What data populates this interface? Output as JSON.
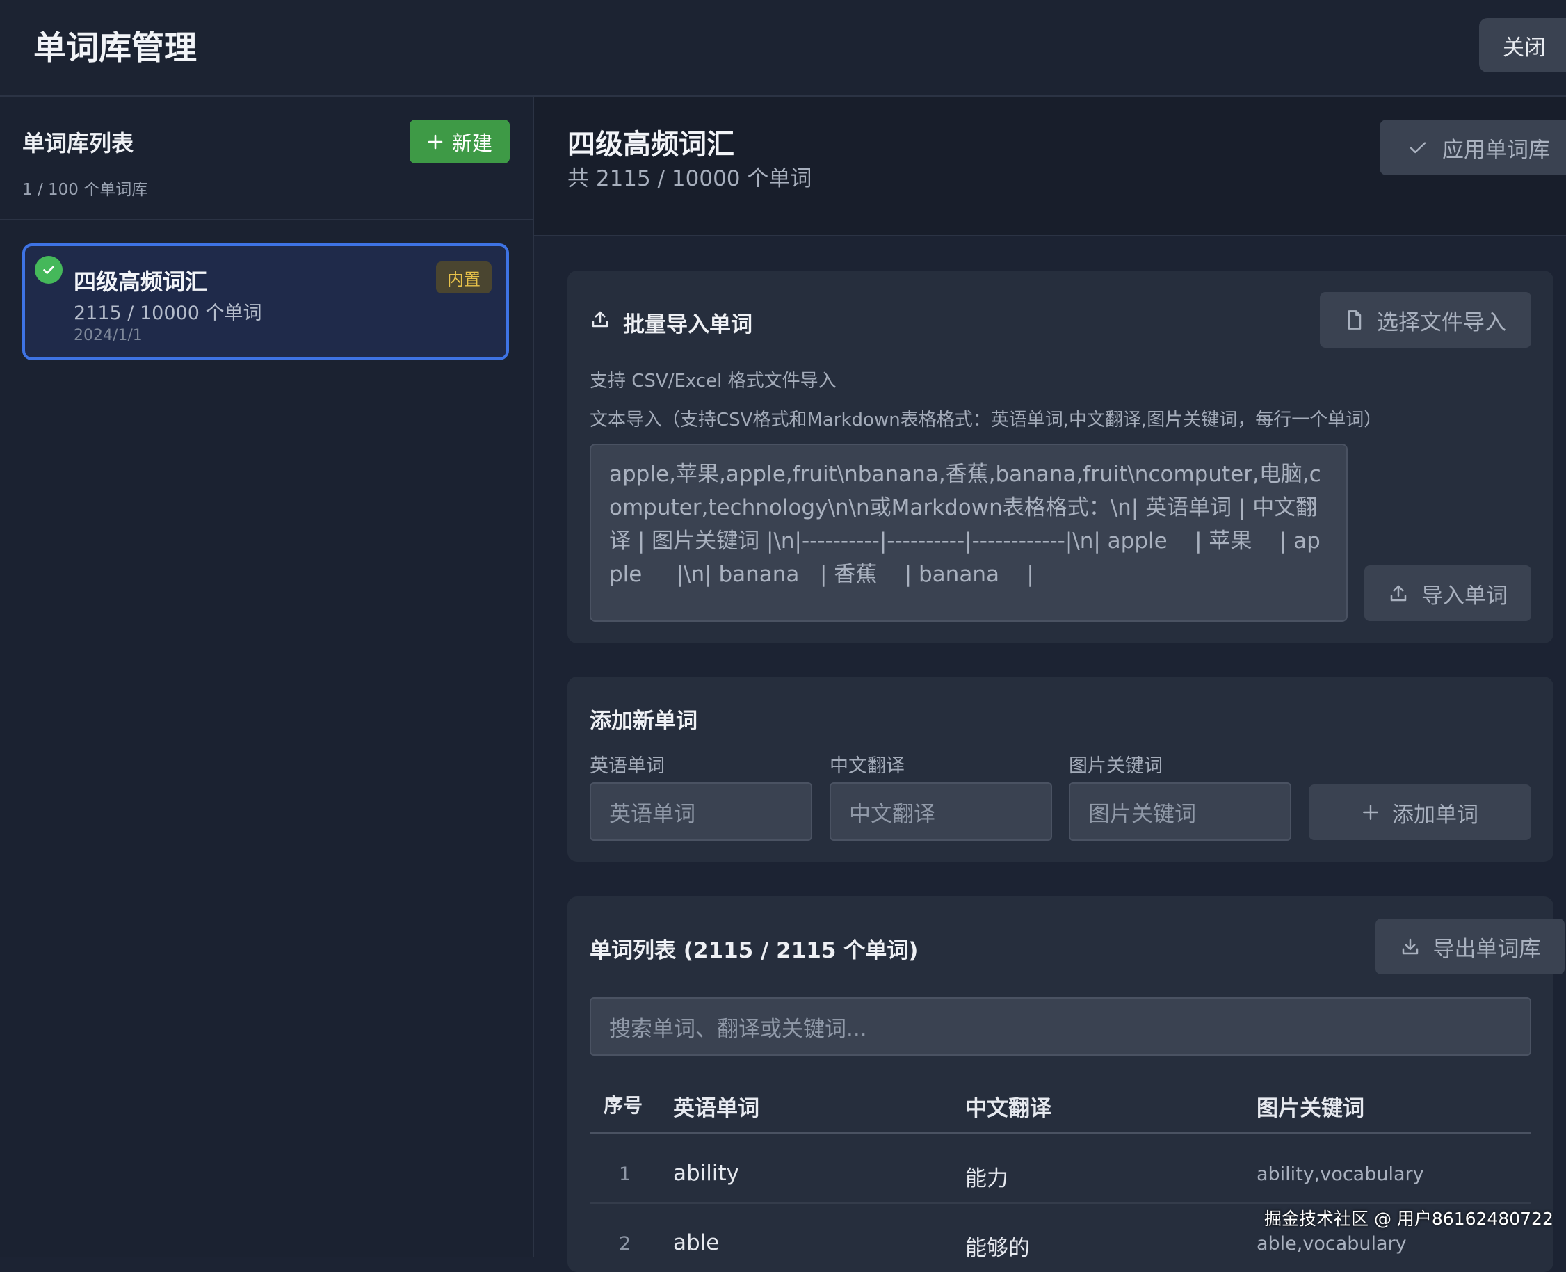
{
  "header": {
    "title": "单词库管理",
    "close_label": "关闭"
  },
  "sidebar": {
    "title": "单词库列表",
    "count": "1 / 100 个单词库",
    "new_label": "新建",
    "libraries": [
      {
        "name": "四级高频词汇",
        "count": "2115 / 10000 个单词",
        "date": "2024/1/1",
        "badge": "内置"
      }
    ]
  },
  "main": {
    "title": "四级高频词汇",
    "count": "共 2115 / 10000 个单词",
    "apply_label": "应用单词库",
    "import": {
      "title": "批量导入单词",
      "file_button": "选择文件导入",
      "hint_file": "支持 CSV/Excel 格式文件导入",
      "hint_text": "文本导入（支持CSV格式和Markdown表格格式：英语单词,中文翻译,图片关键词，每行一个单词）",
      "placeholder": "apple,苹果,apple,fruit\\nbanana,香蕉,banana,fruit\\ncomputer,电脑,computer,technology\\n\\n或Markdown表格格式：\\n| 英语单词 | 中文翻译 | 图片关键词 |\\n|----------|----------|------------|\\n| apple    | 苹果    | apple     |\\n| banana   | 香蕉    | banana    |",
      "import_button": "导入单词"
    },
    "add": {
      "title": "添加新单词",
      "english_label": "英语单词",
      "english_placeholder": "英语单词",
      "chinese_label": "中文翻译",
      "chinese_placeholder": "中文翻译",
      "keyword_label": "图片关键词",
      "keyword_placeholder": "图片关键词",
      "add_button": "添加单词"
    },
    "list": {
      "title": "单词列表 (2115 / 2115 个单词)",
      "export_button": "导出单词库",
      "search_placeholder": "搜索单词、翻译或关键词...",
      "columns": [
        "序号",
        "英语单词",
        "中文翻译",
        "图片关键词"
      ],
      "rows": [
        {
          "index": "1",
          "english": "ability",
          "chinese": "能力",
          "keywords": "ability,vocabulary"
        },
        {
          "index": "2",
          "english": "able",
          "chinese": "能够的",
          "keywords": "able,vocabulary"
        }
      ]
    }
  },
  "watermark": "掘金技术社区 @ 用户86162480722",
  "colors": {
    "accent_blue": "#3e73e4",
    "success_green": "#3e9a46",
    "badge_yellow": "#e8c24a"
  }
}
